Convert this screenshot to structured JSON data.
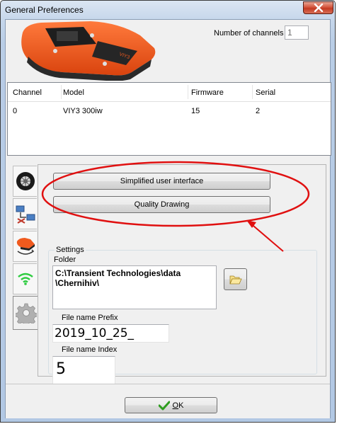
{
  "window": {
    "title": "General Preferences"
  },
  "channels": {
    "label": "Number of channels",
    "value": "1"
  },
  "table": {
    "columns": [
      "Channel",
      "Model",
      "Firmware",
      "Serial"
    ],
    "rows": [
      [
        "0",
        "VIY3 300iw",
        "15",
        "2"
      ]
    ]
  },
  "device_label": "VIY3",
  "buttons": {
    "simplified_ui": "Simplified user interface",
    "quality_drawing": "Quality Drawing"
  },
  "settings": {
    "group_title": "Settings",
    "folder_label": "Folder",
    "folder_value": "C:\\Transient Technologies\\data\n\\Chernihiv\\",
    "prefix_label": "File name Prefix",
    "prefix_value": "2019_10_25_",
    "index_label": "File name Index",
    "index_value": "5"
  },
  "ok_button": {
    "underline": "O",
    "rest": "K"
  },
  "side_tabs": [
    "wheel-icon",
    "network-icon",
    "device-icon",
    "wifi-icon",
    "gear-icon"
  ],
  "colors": {
    "annotation_red": "#e01010",
    "device_orange": "#f05a1e",
    "wifi_green": "#2ecc40",
    "ok_check_green": "#2e9d1f"
  }
}
